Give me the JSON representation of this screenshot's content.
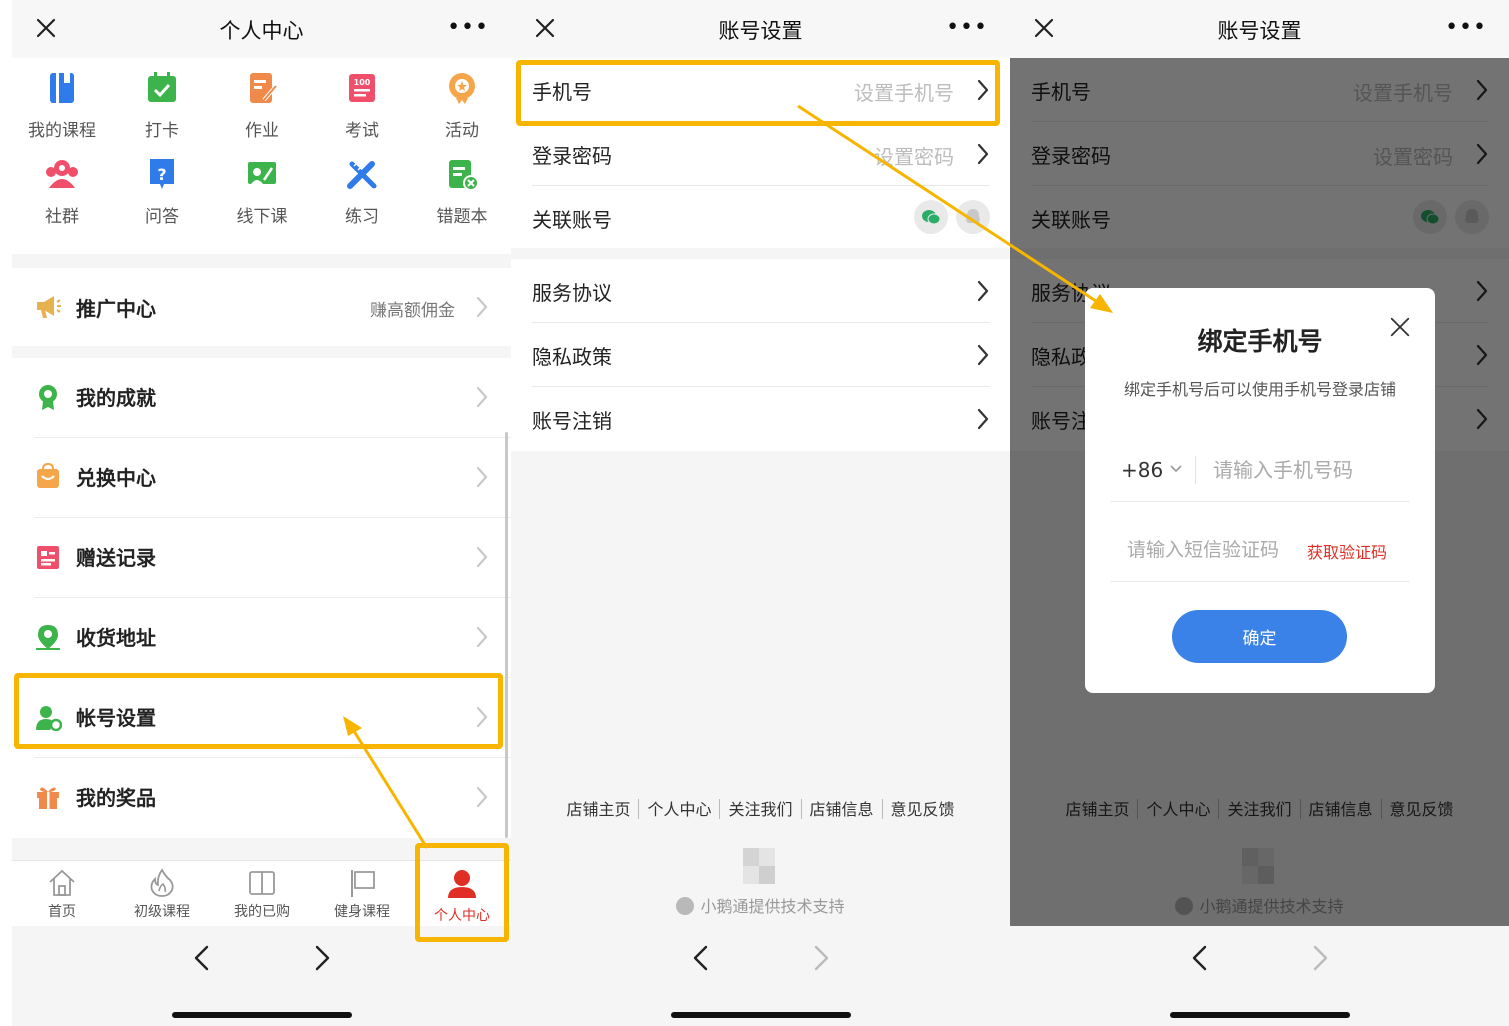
{
  "panel1": {
    "title": "个人中心",
    "grid": [
      {
        "label": "我的课程",
        "icon": "book-icon"
      },
      {
        "label": "打卡",
        "icon": "calendar-check-icon"
      },
      {
        "label": "作业",
        "icon": "homework-icon"
      },
      {
        "label": "考试",
        "icon": "exam-icon"
      },
      {
        "label": "活动",
        "icon": "event-badge-icon"
      },
      {
        "label": "社群",
        "icon": "community-icon"
      },
      {
        "label": "问答",
        "icon": "qa-icon"
      },
      {
        "label": "线下课",
        "icon": "offline-class-icon"
      },
      {
        "label": "练习",
        "icon": "practice-icon"
      },
      {
        "label": "错题本",
        "icon": "mistake-book-icon"
      }
    ],
    "promo": {
      "label": "推广中心",
      "sub": "赚高额佣金"
    },
    "menu": [
      {
        "label": "我的成就",
        "icon": "achievement-icon"
      },
      {
        "label": "兑换中心",
        "icon": "exchange-icon"
      },
      {
        "label": "赠送记录",
        "icon": "gift-record-icon"
      },
      {
        "label": "收货地址",
        "icon": "address-icon"
      },
      {
        "label": "帐号设置",
        "icon": "account-settings-icon"
      },
      {
        "label": "我的奖品",
        "icon": "prize-icon"
      }
    ],
    "tabs": [
      {
        "label": "首页",
        "icon": "home-icon"
      },
      {
        "label": "初级课程",
        "icon": "fire-icon"
      },
      {
        "label": "我的已购",
        "icon": "purchased-icon"
      },
      {
        "label": "健身课程",
        "icon": "flag-icon"
      },
      {
        "label": "个人中心",
        "icon": "user-icon",
        "active": true
      }
    ]
  },
  "settings": {
    "title": "账号设置",
    "phone": {
      "label": "手机号",
      "value": "设置手机号"
    },
    "password": {
      "label": "登录密码",
      "value": "设置密码"
    },
    "linked": {
      "label": "关联账号"
    },
    "agreement": {
      "label": "服务协议"
    },
    "privacy": {
      "label": "隐私政策"
    },
    "cancel": {
      "label": "账号注销"
    },
    "footer_links": [
      "店铺主页",
      "个人中心",
      "关注我们",
      "店铺信息",
      "意见反馈"
    ],
    "credit": "小鹅通提供技术支持"
  },
  "modal": {
    "title": "绑定手机号",
    "desc": "绑定手机号后可以使用手机号登录店铺",
    "country_code": "+86",
    "phone_placeholder": "请输入手机号码",
    "code_placeholder": "请输入短信验证码",
    "get_code": "获取验证码",
    "confirm": "确定"
  },
  "colors": {
    "highlight": "#f7b500",
    "accent_red": "#e02e24",
    "confirm_blue": "#3b82e8",
    "wechat_green": "#2aae67"
  }
}
